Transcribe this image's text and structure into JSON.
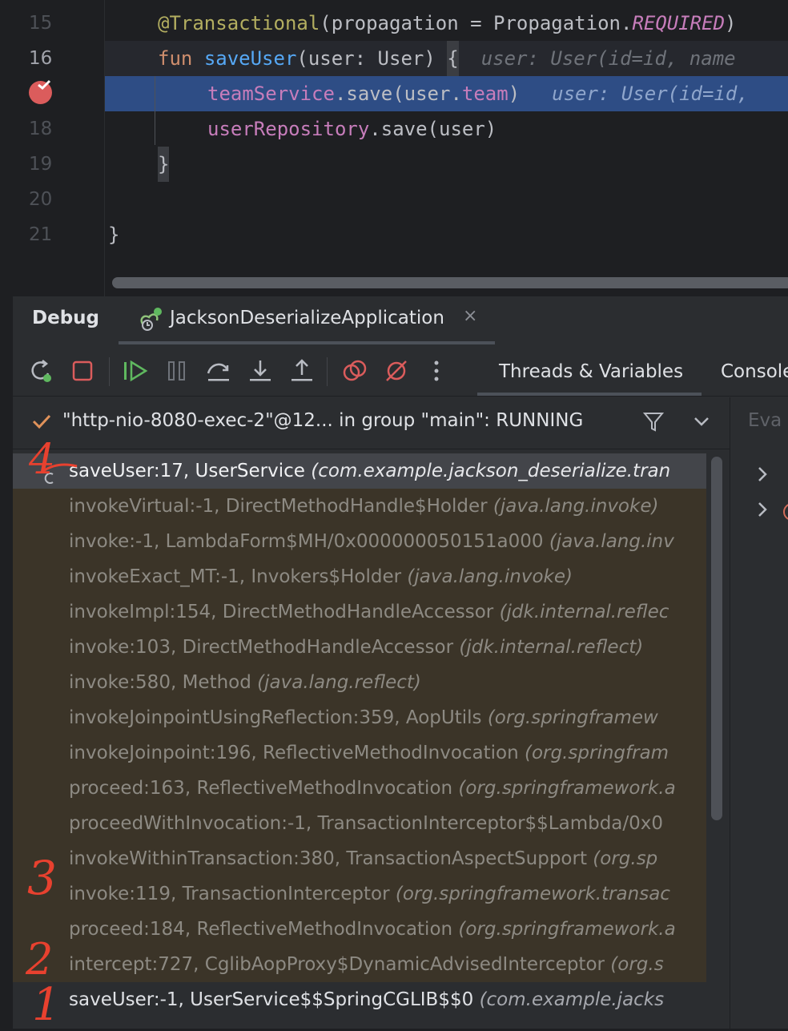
{
  "editor": {
    "lines": [
      {
        "num": "15"
      },
      {
        "num": "16"
      },
      {
        "num": ""
      },
      {
        "num": "18"
      },
      {
        "num": "19"
      },
      {
        "num": "20"
      },
      {
        "num": "21"
      }
    ],
    "code": {
      "l15_annotation": "@Transactional",
      "l15_open": "(propagation = Propagation.",
      "l15_const": "REQUIRED",
      "l15_close": ")",
      "l16_kw": "fun",
      "l16_fn": "saveUser",
      "l16_params": "(user: User) ",
      "l16_brace": "{",
      "l16_hint": "user: User(id=id, name",
      "l17_prop": "teamService",
      "l17_call": ".save(user.",
      "l17_prop2": "team",
      "l17_close": ")",
      "l17_hint": "user: User(id=id,",
      "l18_prop": "userRepository",
      "l18_call": ".save(user)",
      "l19_brace": "}",
      "l21_brace": "}"
    }
  },
  "debug": {
    "title": "Debug",
    "session": "JacksonDeserializeApplication",
    "close": "×",
    "view_tabs": [
      "Threads & Variables",
      "Console"
    ],
    "thread": "\"http-nio-8080-exec-2\"@12... in group \"main\": RUNNING",
    "evaluate_placeholder": "Eva",
    "frames": [
      {
        "method": "saveUser:17, UserService ",
        "pkg": "(com.example.jackson_deserialize.tran",
        "kind": "sel"
      },
      {
        "method": "invokeVirtual:-1, DirectMethodHandle$Holder ",
        "pkg": "(java.lang.invoke)",
        "kind": "lib"
      },
      {
        "method": "invoke:-1, LambdaForm$MH/0x000000050151a000 ",
        "pkg": "(java.lang.inv",
        "kind": "lib"
      },
      {
        "method": "invokeExact_MT:-1, Invokers$Holder ",
        "pkg": "(java.lang.invoke)",
        "kind": "lib"
      },
      {
        "method": "invokeImpl:154, DirectMethodHandleAccessor ",
        "pkg": "(jdk.internal.reflec",
        "kind": "lib"
      },
      {
        "method": "invoke:103, DirectMethodHandleAccessor ",
        "pkg": "(jdk.internal.reflect)",
        "kind": "lib"
      },
      {
        "method": "invoke:580, Method ",
        "pkg": "(java.lang.reflect)",
        "kind": "lib"
      },
      {
        "method": "invokeJoinpointUsingReflection:359, AopUtils ",
        "pkg": "(org.springframew",
        "kind": "lib"
      },
      {
        "method": "invokeJoinpoint:196, ReflectiveMethodInvocation ",
        "pkg": "(org.springfram",
        "kind": "lib"
      },
      {
        "method": "proceed:163, ReflectiveMethodInvocation ",
        "pkg": "(org.springframework.a",
        "kind": "lib"
      },
      {
        "method": "proceedWithInvocation:-1, TransactionInterceptor$$Lambda/0x0",
        "pkg": "",
        "kind": "lib"
      },
      {
        "method": "invokeWithinTransaction:380, TransactionAspectSupport ",
        "pkg": "(org.sp",
        "kind": "lib"
      },
      {
        "method": "invoke:119, TransactionInterceptor ",
        "pkg": "(org.springframework.transac",
        "kind": "lib"
      },
      {
        "method": "proceed:184, ReflectiveMethodInvocation ",
        "pkg": "(org.springframework.a",
        "kind": "lib"
      },
      {
        "method": "intercept:727, CglibAopProxy$DynamicAdvisedInterceptor ",
        "pkg": "(org.s",
        "kind": "lib"
      },
      {
        "method": "saveUser:-1, UserService$$SpringCGLIB$$0 ",
        "pkg": "(com.example.jacks",
        "kind": "app"
      }
    ]
  },
  "annotations": {
    "a4": "4",
    "a3": "3",
    "a2": "2",
    "a1": "1"
  },
  "colors": {
    "execution_line": "#2e4d85",
    "library_frame": "#3b3428",
    "breakpoint": "#db5c5c",
    "annotation_red": "#e8412f"
  }
}
